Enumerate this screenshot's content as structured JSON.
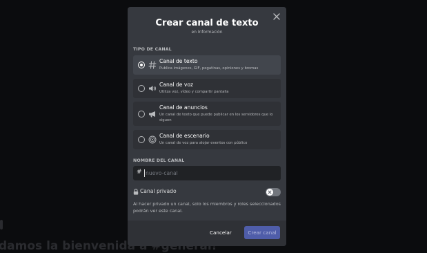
{
  "background": {
    "heading": "damos la bienvenida a #general!"
  },
  "modal": {
    "title": "Crear canal de texto",
    "subtitle": "en Información",
    "close_icon": "close-icon",
    "channel_type_label": "TIPO DE CANAL",
    "options": [
      {
        "title": "Canal de texto",
        "description": "Publica imágenes, GIF, pegatinas, opiniones y bromas",
        "icon": "hash-icon",
        "selected": true
      },
      {
        "title": "Canal de voz",
        "description": "Utiliza voz, vídeo y compartir pantalla",
        "icon": "speaker-icon",
        "selected": false
      },
      {
        "title": "Canal de anuncios",
        "description": "Un canal de texto que puede publicar en los servidores que lo siguen",
        "icon": "megaphone-icon",
        "selected": false
      },
      {
        "title": "Canal de escenario",
        "description": "Un canal de voz para alojar eventos con público",
        "icon": "stage-icon",
        "selected": false
      }
    ],
    "name_label": "NOMBRE DEL CANAL",
    "name_input": {
      "prefix": "#",
      "placeholder": "nuevo-canal",
      "value": ""
    },
    "private": {
      "label": "Canal privado",
      "enabled": false,
      "description": "Al hacer privado un canal, solo los miembros y roles seleccionados podrán ver este canal."
    },
    "footer": {
      "cancel_label": "Cancelar",
      "create_label": "Crear canal"
    }
  },
  "colors": {
    "modal_bg": "#36393f",
    "selected_option_bg": "#42464d",
    "option_bg": "#2f3136",
    "input_bg": "#202225",
    "create_button": "#4f5da9",
    "page_bg": "#0b0c0e"
  }
}
